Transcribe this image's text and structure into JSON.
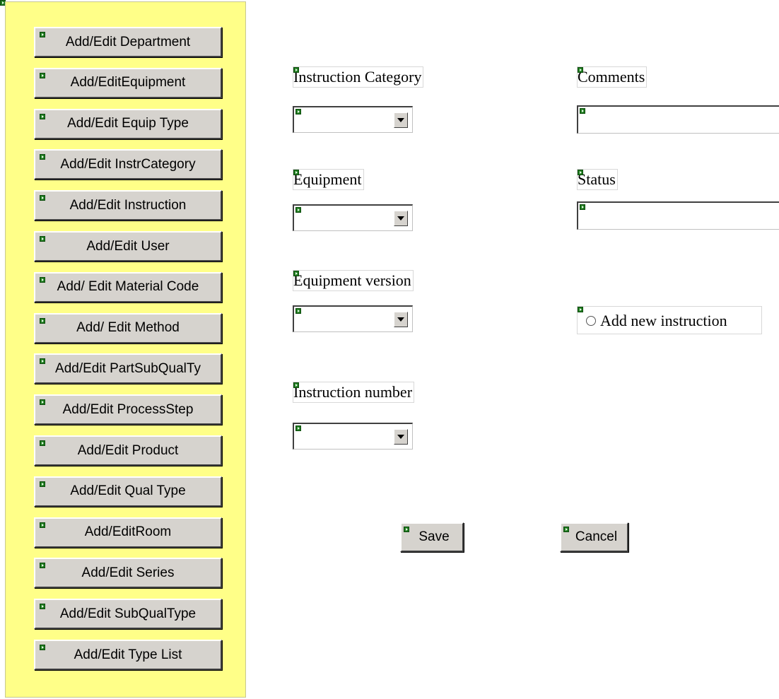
{
  "sidebar": {
    "background": "#ffff88",
    "buttons": [
      "Add/Edit Department",
      "Add/EditEquipment",
      "Add/Edit Equip Type",
      "Add/Edit InstrCategory",
      "Add/Edit Instruction",
      "Add/Edit User",
      "Add/ Edit Material Code",
      "Add/ Edit Method",
      "Add/Edit PartSubQualTy",
      "Add/Edit ProcessStep",
      "Add/Edit Product",
      "Add/Edit Qual Type",
      "Add/EditRoom",
      "Add/Edit Series",
      "Add/Edit SubQualType",
      "Add/Edit Type List"
    ]
  },
  "form": {
    "instruction_category": {
      "label": "Instruction Category",
      "value": ""
    },
    "equipment": {
      "label": "Equipment",
      "value": ""
    },
    "equipment_version": {
      "label": "Equipment version",
      "value": ""
    },
    "instruction_number": {
      "label": "Instruction number",
      "value": ""
    },
    "comments": {
      "label": "Comments",
      "value": ""
    },
    "status": {
      "label": "Status",
      "value": ""
    },
    "add_new_instruction": {
      "label": "Add new instruction",
      "checked": false
    }
  },
  "actions": {
    "save": "Save",
    "cancel": "Cancel"
  },
  "icons": {
    "marker": "design-marker-icon",
    "dropdown_arrow": "chevron-down-icon",
    "radio": "radio-button-icon"
  }
}
